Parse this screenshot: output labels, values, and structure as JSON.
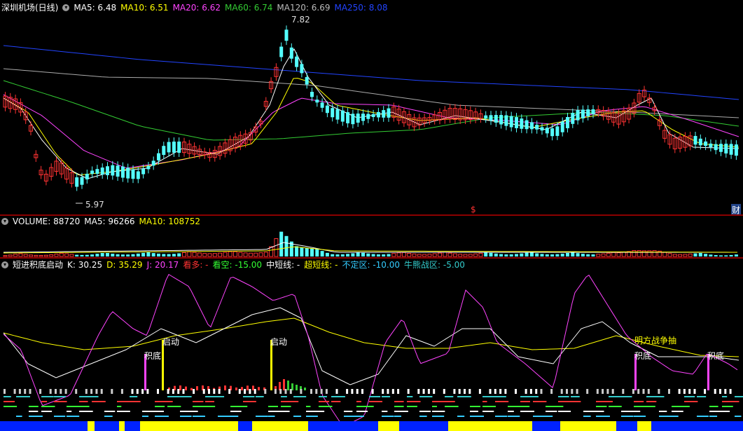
{
  "price_panel": {
    "title": "深圳机场(日线)",
    "ma": [
      {
        "label": "MA5: 6.48",
        "color": "#ffffff"
      },
      {
        "label": "MA10: 6.51",
        "color": "#ffff00"
      },
      {
        "label": "MA20: 6.62",
        "color": "#ff44ff"
      },
      {
        "label": "MA60: 6.74",
        "color": "#33cc33"
      },
      {
        "label": "MA120: 6.69",
        "color": "#bbbbbb"
      },
      {
        "label": "MA250: 8.08",
        "color": "#2244ff"
      }
    ],
    "high_label": "7.82",
    "low_label": "5.97",
    "dollar_marker": "$",
    "fin_marker": "财"
  },
  "volume_panel": {
    "labels": [
      {
        "label": "VOLUME: 88720",
        "color": "#ffffff"
      },
      {
        "label": "MA5: 96266",
        "color": "#ffffff"
      },
      {
        "label": "MA10: 108752",
        "color": "#ffff00"
      }
    ]
  },
  "indicator_panel": {
    "name": "短进积底启动",
    "labels": [
      {
        "label": "K: 30.25",
        "color": "#ffffff"
      },
      {
        "label": "D: 35.29",
        "color": "#ffff00"
      },
      {
        "label": "J: 20.17",
        "color": "#ff44ff"
      },
      {
        "label": "看多: -",
        "color": "#ff3333"
      },
      {
        "label": "看空: -15.00",
        "color": "#33ff33"
      },
      {
        "label": "中短线: -",
        "color": "#ffffff"
      },
      {
        "label": "超短线: -",
        "color": "#ffff00"
      },
      {
        "label": "不定区: -10.00",
        "color": "#33ccff"
      },
      {
        "label": "牛熊战区: -5.00",
        "color": "#33cccc"
      }
    ],
    "signals": {
      "jidi": "积底",
      "qidong": "启动",
      "mingfang": "明方战争抽"
    }
  },
  "colors": {
    "up": "#ff3333",
    "down": "#54ffff",
    "bg": "#000000",
    "separator": "#8b0000"
  }
}
